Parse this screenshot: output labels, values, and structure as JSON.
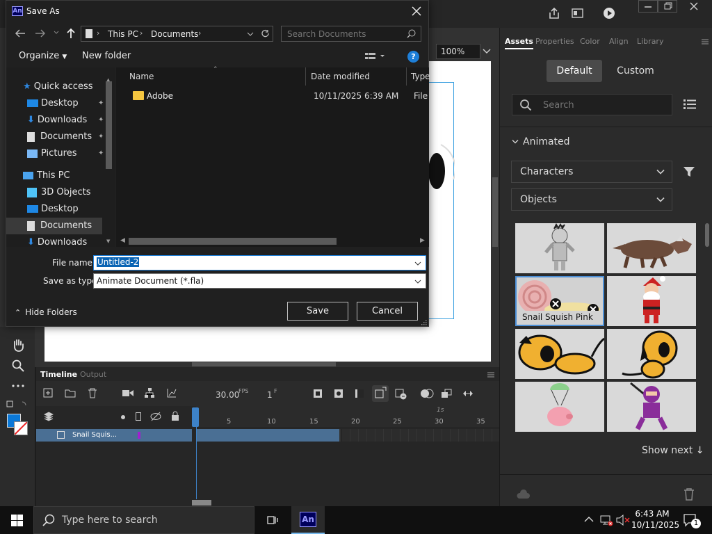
{
  "dialog": {
    "title": "Save As",
    "app_badge": "An",
    "breadcrumb": [
      "This PC",
      "Documents"
    ],
    "search_placeholder": "Search Documents",
    "toolbar": {
      "organize": "Organize",
      "new_folder": "New folder",
      "help": "?"
    },
    "sidebar": [
      {
        "label": "Quick access",
        "icon": "star-icon",
        "pinned": false
      },
      {
        "label": "Desktop",
        "icon": "desktop-icon",
        "pinned": true
      },
      {
        "label": "Downloads",
        "icon": "download-icon",
        "pinned": true
      },
      {
        "label": "Documents",
        "icon": "document-icon",
        "pinned": true
      },
      {
        "label": "Pictures",
        "icon": "pictures-icon",
        "pinned": true
      },
      {
        "label": "This PC",
        "icon": "pc-icon",
        "pinned": false
      },
      {
        "label": "3D Objects",
        "icon": "cube-icon",
        "pinned": false
      },
      {
        "label": "Desktop",
        "icon": "desktop-icon",
        "pinned": false
      },
      {
        "label": "Documents",
        "icon": "document-icon",
        "pinned": false
      },
      {
        "label": "Downloads",
        "icon": "download-icon",
        "pinned": false
      }
    ],
    "columns": {
      "name": "Name",
      "date": "Date modified",
      "type": "Type"
    },
    "files": [
      {
        "name": "Adobe",
        "date": "10/11/2025 6:39 AM",
        "type": "File fo"
      }
    ],
    "file_name_label": "File name:",
    "file_name_value": "Untitled-2",
    "save_type_label": "Save as type:",
    "save_type_value": "Animate Document (*.fla)",
    "hide_folders": "Hide Folders",
    "save_button": "Save",
    "cancel_button": "Cancel"
  },
  "stage": {
    "zoom": "100%"
  },
  "right_panel": {
    "tabs": [
      "Assets",
      "Properties",
      "Color",
      "Align",
      "Library"
    ],
    "active_tab": "Assets",
    "segments": [
      "Default",
      "Custom"
    ],
    "search_placeholder": "Search",
    "section": "Animated",
    "dropdown1": "Characters",
    "dropdown2": "Objects",
    "tile_caption": "Snail Squish Pink",
    "show_next": "Show next"
  },
  "timeline": {
    "tabs": [
      "Timeline",
      "Output"
    ],
    "fps": "30.00",
    "fps_label": "FPS",
    "frame": "1",
    "frame_label": "F",
    "ruler": [
      "5",
      "10",
      "15",
      "20",
      "25",
      "30",
      "35"
    ],
    "second_marker": "1s",
    "layer_name": "Snail Squis..."
  },
  "taskbar": {
    "search_placeholder": "Type here to search",
    "app_badge": "An",
    "time": "6:43 AM",
    "date": "10/11/2025",
    "notification_count": "1"
  },
  "colors": {
    "accent": "#0078d7",
    "selection_blue": "#0a64b4",
    "layer_blue": "#4a6f94"
  }
}
